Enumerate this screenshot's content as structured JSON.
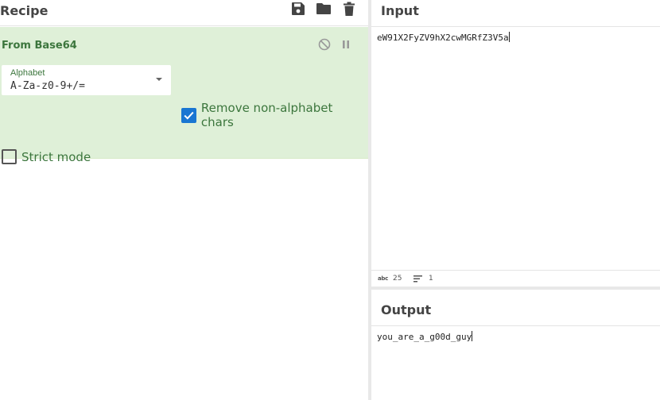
{
  "recipe": {
    "title": "Recipe",
    "icons": [
      "save-icon",
      "folder-icon",
      "trash-icon"
    ]
  },
  "operation": {
    "title": "From Base64",
    "icons": [
      "disable-icon",
      "pause-icon"
    ],
    "alphabet": {
      "label": "Alphabet",
      "value": "A-Za-z0-9+/="
    },
    "remove_non_alphabet": {
      "label": "Remove non-alphabet chars",
      "checked": true
    },
    "strict_mode": {
      "label": "Strict mode",
      "checked": false
    }
  },
  "input": {
    "title": "Input",
    "text": "eW91X2FyZV9hX2cwMGRfZ3V5a",
    "status": {
      "length_icon": "abc",
      "length": "25",
      "lines_icon": "lines-icon",
      "lines": "1"
    }
  },
  "output": {
    "title": "Output",
    "text": "you_are_a_g00d_guy"
  },
  "colors": {
    "operation_bg": "#dff0d8",
    "operation_text": "#3c763d",
    "checkbox_checked": "#1976d2"
  }
}
